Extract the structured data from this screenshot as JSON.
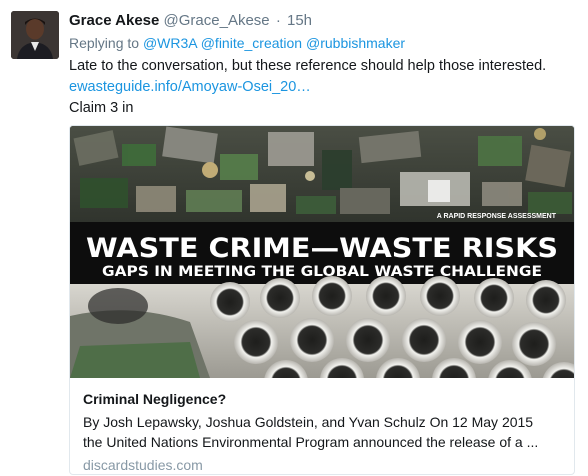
{
  "tweet": {
    "author_name": "Grace Akese",
    "author_handle": "@Grace_Akese",
    "time_separator": "·",
    "timestamp": "15h",
    "replying_prefix": "Replying to",
    "replying_to": [
      "@WR3A",
      "@finite_creation",
      "@rubbishmaker"
    ],
    "text_line": "Late to the conversation, but these reference should help those interested.",
    "link_text": "ewasteguide.info/Amoyaw-Osei_20…",
    "claim_text": "Claim 3 in"
  },
  "card": {
    "image": {
      "kicker": "A RAPID RESPONSE ASSESSMENT",
      "headline": "WASTE CRIME—WASTE RISKS",
      "subheadline": "GAPS IN MEETING THE GLOBAL WASTE CHALLENGE"
    },
    "title": "Criminal Negligence?",
    "description_line1": "By Josh Lepawsky, Joshua Goldstein, and Yvan Schulz On 12 May 2015",
    "description_line2": "the United Nations Environmental Program announced the release of a ...",
    "domain": "discardstudies.com"
  },
  "colors": {
    "link": "#1b95e0",
    "muted": "#657786",
    "domain": "#8899a6",
    "text": "#14171a",
    "border": "#e1e8ed",
    "banner": "#0d0d0d"
  }
}
